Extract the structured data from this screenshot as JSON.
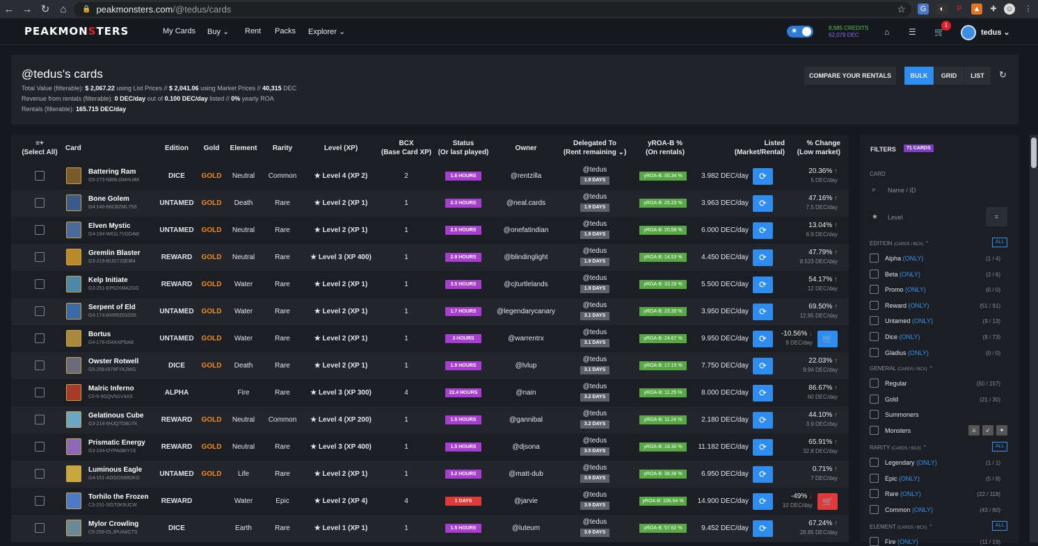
{
  "browser": {
    "url_host": "peakmonsters.com",
    "url_path": "/@tedus/cards"
  },
  "topnav": {
    "logo_a": "PEAKMON",
    "logo_b": "S",
    "logo_c": "TERS",
    "items": [
      "My Cards",
      "Buy",
      "Rent",
      "Packs",
      "Explorer"
    ],
    "credits": "8,985 CREDITS",
    "dec": "62,079 DEC",
    "cart_count": "1",
    "user": "tedus"
  },
  "header": {
    "title": "@tedus's cards",
    "l1a": "Total Value (filterable):",
    "l1b": "$ 2,067.22",
    "l1c": "using List Prices //",
    "l1d": "$ 2,041.06",
    "l1e": "using Market Prices //",
    "l1f": "40,315",
    "l1g": "DEC",
    "l2a": "Revenue from rentals (filterable):",
    "l2b": "0 DEC/day",
    "l2c": "out of",
    "l2d": "0.100 DEC/day",
    "l2e": "listed //",
    "l2f": "0%",
    "l2g": "yearly ROA",
    "l3a": "Rentals (filterable):",
    "l3b": "165.715 DEC/day",
    "compare": "COMPARE YOUR RENTALS",
    "bulk": "BULK",
    "grid": "GRID",
    "list": "LIST"
  },
  "columns": {
    "select": "(Select All)",
    "card": "Card",
    "edition": "Edition",
    "gold": "Gold",
    "element": "Element",
    "rarity": "Rarity",
    "level": "Level (XP)",
    "bcx": "BCX",
    "bcx2": "(Base Card XP)",
    "status": "Status",
    "status2": "(Or last played)",
    "owner": "Owner",
    "deleg": "Delegated To",
    "deleg2": "(Rent remaining ⌄)",
    "yroa": "yROA-B %",
    "yroa2": "(On rentals)",
    "listed": "Listed",
    "listed2": "(Market/Rental)",
    "change": "% Change",
    "change2": "(Low market)"
  },
  "rows": [
    {
      "name": "Battering Ram",
      "id": "G5-273-NB9LGMHUBK",
      "edition": "DICE",
      "gold": "GOLD",
      "element": "Neutral",
      "rarity": "Common",
      "level": "Level 4 (XP 2)",
      "bcx": "2",
      "status": "1.6 HOURS",
      "owner": "@rentzilla",
      "deleg": "@tedus",
      "days": "1.9 DAYS",
      "yroa": "yROA-B: 30.34 %",
      "listed": "3.982 DEC/day",
      "pct": "20.36%",
      "dir": "up",
      "low": "5 DEC/day"
    },
    {
      "name": "Bone Golem",
      "id": "G4-140-66CBZML75S",
      "edition": "UNTAMED",
      "gold": "GOLD",
      "element": "Death",
      "rarity": "Rare",
      "level": "Level 2 (XP 1)",
      "bcx": "1",
      "status": "2.3 HOURS",
      "owner": "@neal.cards",
      "deleg": "@tedus",
      "days": "1.9 DAYS",
      "yroa": "yROA-B: 25.23 %",
      "listed": "3.963 DEC/day",
      "pct": "47.16%",
      "dir": "up",
      "low": "7.5 DEC/day"
    },
    {
      "name": "Elven Mystic",
      "id": "G4-194-W61L7VDD4W",
      "edition": "UNTAMED",
      "gold": "GOLD",
      "element": "Neutral",
      "rarity": "Rare",
      "level": "Level 2 (XP 1)",
      "bcx": "1",
      "status": "2.5 HOURS",
      "owner": "@onefatindian",
      "deleg": "@tedus",
      "days": "1.9 DAYS",
      "yroa": "yROA-B: 20.58 %",
      "listed": "6.000 DEC/day",
      "pct": "13.04%",
      "dir": "up",
      "low": "6.9 DEC/day"
    },
    {
      "name": "Gremlin Blaster",
      "id": "G3-219-BUD7JSEIB4",
      "edition": "REWARD",
      "gold": "GOLD",
      "element": "Neutral",
      "rarity": "Rare",
      "level": "Level 3 (XP 400)",
      "bcx": "1",
      "status": "2.9 HOURS",
      "owner": "@blindinglight",
      "deleg": "@tedus",
      "days": "1.9 DAYS",
      "yroa": "yROA-B: 14.53 %",
      "listed": "4.450 DEC/day",
      "pct": "47.79%",
      "dir": "up",
      "low": "8.523 DEC/day"
    },
    {
      "name": "Kelp Initiate",
      "id": "G3-251-EP62XMA2GG",
      "edition": "REWARD",
      "gold": "GOLD",
      "element": "Water",
      "rarity": "Rare",
      "level": "Level 2 (XP 1)",
      "bcx": "1",
      "status": "3.5 HOURS",
      "owner": "@cjturtlelands",
      "deleg": "@tedus",
      "days": "1.9 DAYS",
      "yroa": "yROA-B: 33.28 %",
      "listed": "5.500 DEC/day",
      "pct": "54.17%",
      "dir": "up",
      "low": "12 DEC/day"
    },
    {
      "name": "Serpent of Eld",
      "id": "G4-174-8XRRZ03S55",
      "edition": "UNTAMED",
      "gold": "GOLD",
      "element": "Water",
      "rarity": "Rare",
      "level": "Level 2 (XP 1)",
      "bcx": "1",
      "status": "1.7 HOURS",
      "owner": "@legendarycanary",
      "deleg": "@tedus",
      "days": "3.1 DAYS",
      "yroa": "yROA-B: 23.39 %",
      "listed": "3.950 DEC/day",
      "pct": "69.50%",
      "dir": "up",
      "low": "12.95 DEC/day"
    },
    {
      "name": "Bortus",
      "id": "G4-178-ID4XXP5IA8",
      "edition": "UNTAMED",
      "gold": "GOLD",
      "element": "Water",
      "rarity": "Rare",
      "level": "Level 2 (XP 1)",
      "bcx": "1",
      "status": "3 HOURS",
      "owner": "@warrentrx",
      "deleg": "@tedus",
      "days": "3.1 DAYS",
      "yroa": "yROA-B: 24.67 %",
      "listed": "9.950 DEC/day",
      "pct": "-10.56%",
      "dir": "dn",
      "low": "9 DEC/day",
      "cart": "blue"
    },
    {
      "name": "Owster Rotwell",
      "id": "G5-258-I979FYKJWG",
      "edition": "DICE",
      "gold": "GOLD",
      "element": "Death",
      "rarity": "Rare",
      "level": "Level 2 (XP 1)",
      "bcx": "1",
      "status": "1.9 HOURS",
      "owner": "@lvlup",
      "deleg": "@tedus",
      "days": "3.1 DAYS",
      "yroa": "yROA-B: 17.15 %",
      "listed": "7.750 DEC/day",
      "pct": "22.03%",
      "dir": "up",
      "low": "9.94 DEC/day"
    },
    {
      "name": "Malric Inferno",
      "id": "C0-5-9GQVN1V4XS",
      "edition": "ALPHA",
      "gold": "",
      "element": "Fire",
      "rarity": "Rare",
      "level": "Level 3 (XP 300)",
      "bcx": "4",
      "status": "22.4 HOURS",
      "owner": "@nain",
      "deleg": "@tedus",
      "days": "3.2 DAYS",
      "yroa": "yROA-B: 11.25 %",
      "listed": "8.000 DEC/day",
      "pct": "86.67%",
      "dir": "up",
      "low": "60 DEC/day"
    },
    {
      "name": "Gelatinous Cube",
      "id": "G3-218-5HJQTO8U7K",
      "edition": "REWARD",
      "gold": "GOLD",
      "element": "Neutral",
      "rarity": "Common",
      "level": "Level 4 (XP 200)",
      "bcx": "1",
      "status": "1.5 HOURS",
      "owner": "@gannibal",
      "deleg": "@tedus",
      "days": "3.2 DAYS",
      "yroa": "yROA-B: 11.24 %",
      "listed": "2.180 DEC/day",
      "pct": "44.10%",
      "dir": "up",
      "low": "3.9 DEC/day"
    },
    {
      "name": "Prismatic Energy",
      "id": "G3-104-OYPA0BIY1S",
      "edition": "REWARD",
      "gold": "GOLD",
      "element": "Neutral",
      "rarity": "Rare",
      "level": "Level 3 (XP 400)",
      "bcx": "1",
      "status": "1.5 HOURS",
      "owner": "@djsona",
      "deleg": "@tedus",
      "days": "3.5 DAYS",
      "yroa": "yROA-B: 18.30 %",
      "listed": "11.182 DEC/day",
      "pct": "65.91%",
      "dir": "up",
      "low": "32.8 DEC/day"
    },
    {
      "name": "Luminous Eagle",
      "id": "G4-151-ADGOS68DKG",
      "edition": "UNTAMED",
      "gold": "GOLD",
      "element": "Life",
      "rarity": "Rare",
      "level": "Level 2 (XP 1)",
      "bcx": "1",
      "status": "3.2 HOURS",
      "owner": "@matt-dub",
      "deleg": "@tedus",
      "days": "3.9 DAYS",
      "yroa": "yROA-B: 38.36 %",
      "listed": "6.950 DEC/day",
      "pct": "0.71%",
      "dir": "up",
      "low": "7 DEC/day"
    },
    {
      "name": "Torhilo the Frozen",
      "id": "C3-231-3IGT0K6UCW",
      "edition": "REWARD",
      "gold": "",
      "element": "Water",
      "rarity": "Epic",
      "level": "Level 2 (XP 4)",
      "bcx": "4",
      "status": "1 DAYS",
      "owner": "@jarvie",
      "deleg": "@tedus",
      "days": "3.9 DAYS",
      "yroa": "yROA-B: 106.94 %",
      "listed": "14.900 DEC/day",
      "pct": "-49%",
      "dir": "dn",
      "low": "10 DEC/day",
      "cart": "red"
    },
    {
      "name": "Mylor Crowling",
      "id": "C5-259-OLJPUA6CTS",
      "edition": "DICE",
      "gold": "",
      "element": "Earth",
      "rarity": "Rare",
      "level": "Level 1 (XP 1)",
      "bcx": "1",
      "status": "1.5 HOURS",
      "owner": "@luteum",
      "deleg": "@tedus",
      "days": "3.9 DAYS",
      "yroa": "yROA-B: 57.62 %",
      "listed": "9.452 DEC/day",
      "pct": "67.24%",
      "dir": "up",
      "low": "28.85 DEC/day"
    }
  ],
  "filters": {
    "title": "FILTERS",
    "count": "71 CARDS",
    "card": "CARD",
    "search_ph": "Name / ID",
    "level_ph": "Level",
    "eq": "=",
    "all": "ALL",
    "only": "(ONLY)",
    "edition_title": "EDITION",
    "edition_sub": "(CARDS / BCX)",
    "editions": [
      {
        "l": "Alpha",
        "c": "(1 / 4)"
      },
      {
        "l": "Beta",
        "c": "(2 / 6)"
      },
      {
        "l": "Promo",
        "c": "(0 / 0)"
      },
      {
        "l": "Reward",
        "c": "(51 / 91)"
      },
      {
        "l": "Untamed",
        "c": "(9 / 13)"
      },
      {
        "l": "Dice",
        "c": "(8 / 73)"
      },
      {
        "l": "Gladius",
        "c": "(0 / 0)"
      }
    ],
    "general_title": "GENERAL",
    "general_sub": "(CARDS / BCX)",
    "general": [
      {
        "l": "Regular",
        "c": "(50 / 157)"
      },
      {
        "l": "Gold",
        "c": "(21 / 30)"
      },
      {
        "l": "Summoners",
        "c": ""
      },
      {
        "l": "Monsters",
        "c": ""
      }
    ],
    "rarity_title": "RARITY",
    "rarity_sub": "(CARDS / BCX)",
    "rarity": [
      {
        "l": "Legendary",
        "c": "(1 / 1)"
      },
      {
        "l": "Epic",
        "c": "(5 / 8)"
      },
      {
        "l": "Rare",
        "c": "(22 / 118)"
      },
      {
        "l": "Common",
        "c": "(43 / 60)"
      }
    ],
    "element_title": "ELEMENT",
    "element_sub": "(CARDS / BCX)",
    "element": [
      {
        "l": "Fire",
        "c": "(11 / 19)"
      }
    ]
  },
  "colors": {
    "accent": "#2e8df0",
    "status": "#a83ed0",
    "status_red": "#e03a3a",
    "yroa": "#58a846",
    "gold": "#f28a1e"
  }
}
